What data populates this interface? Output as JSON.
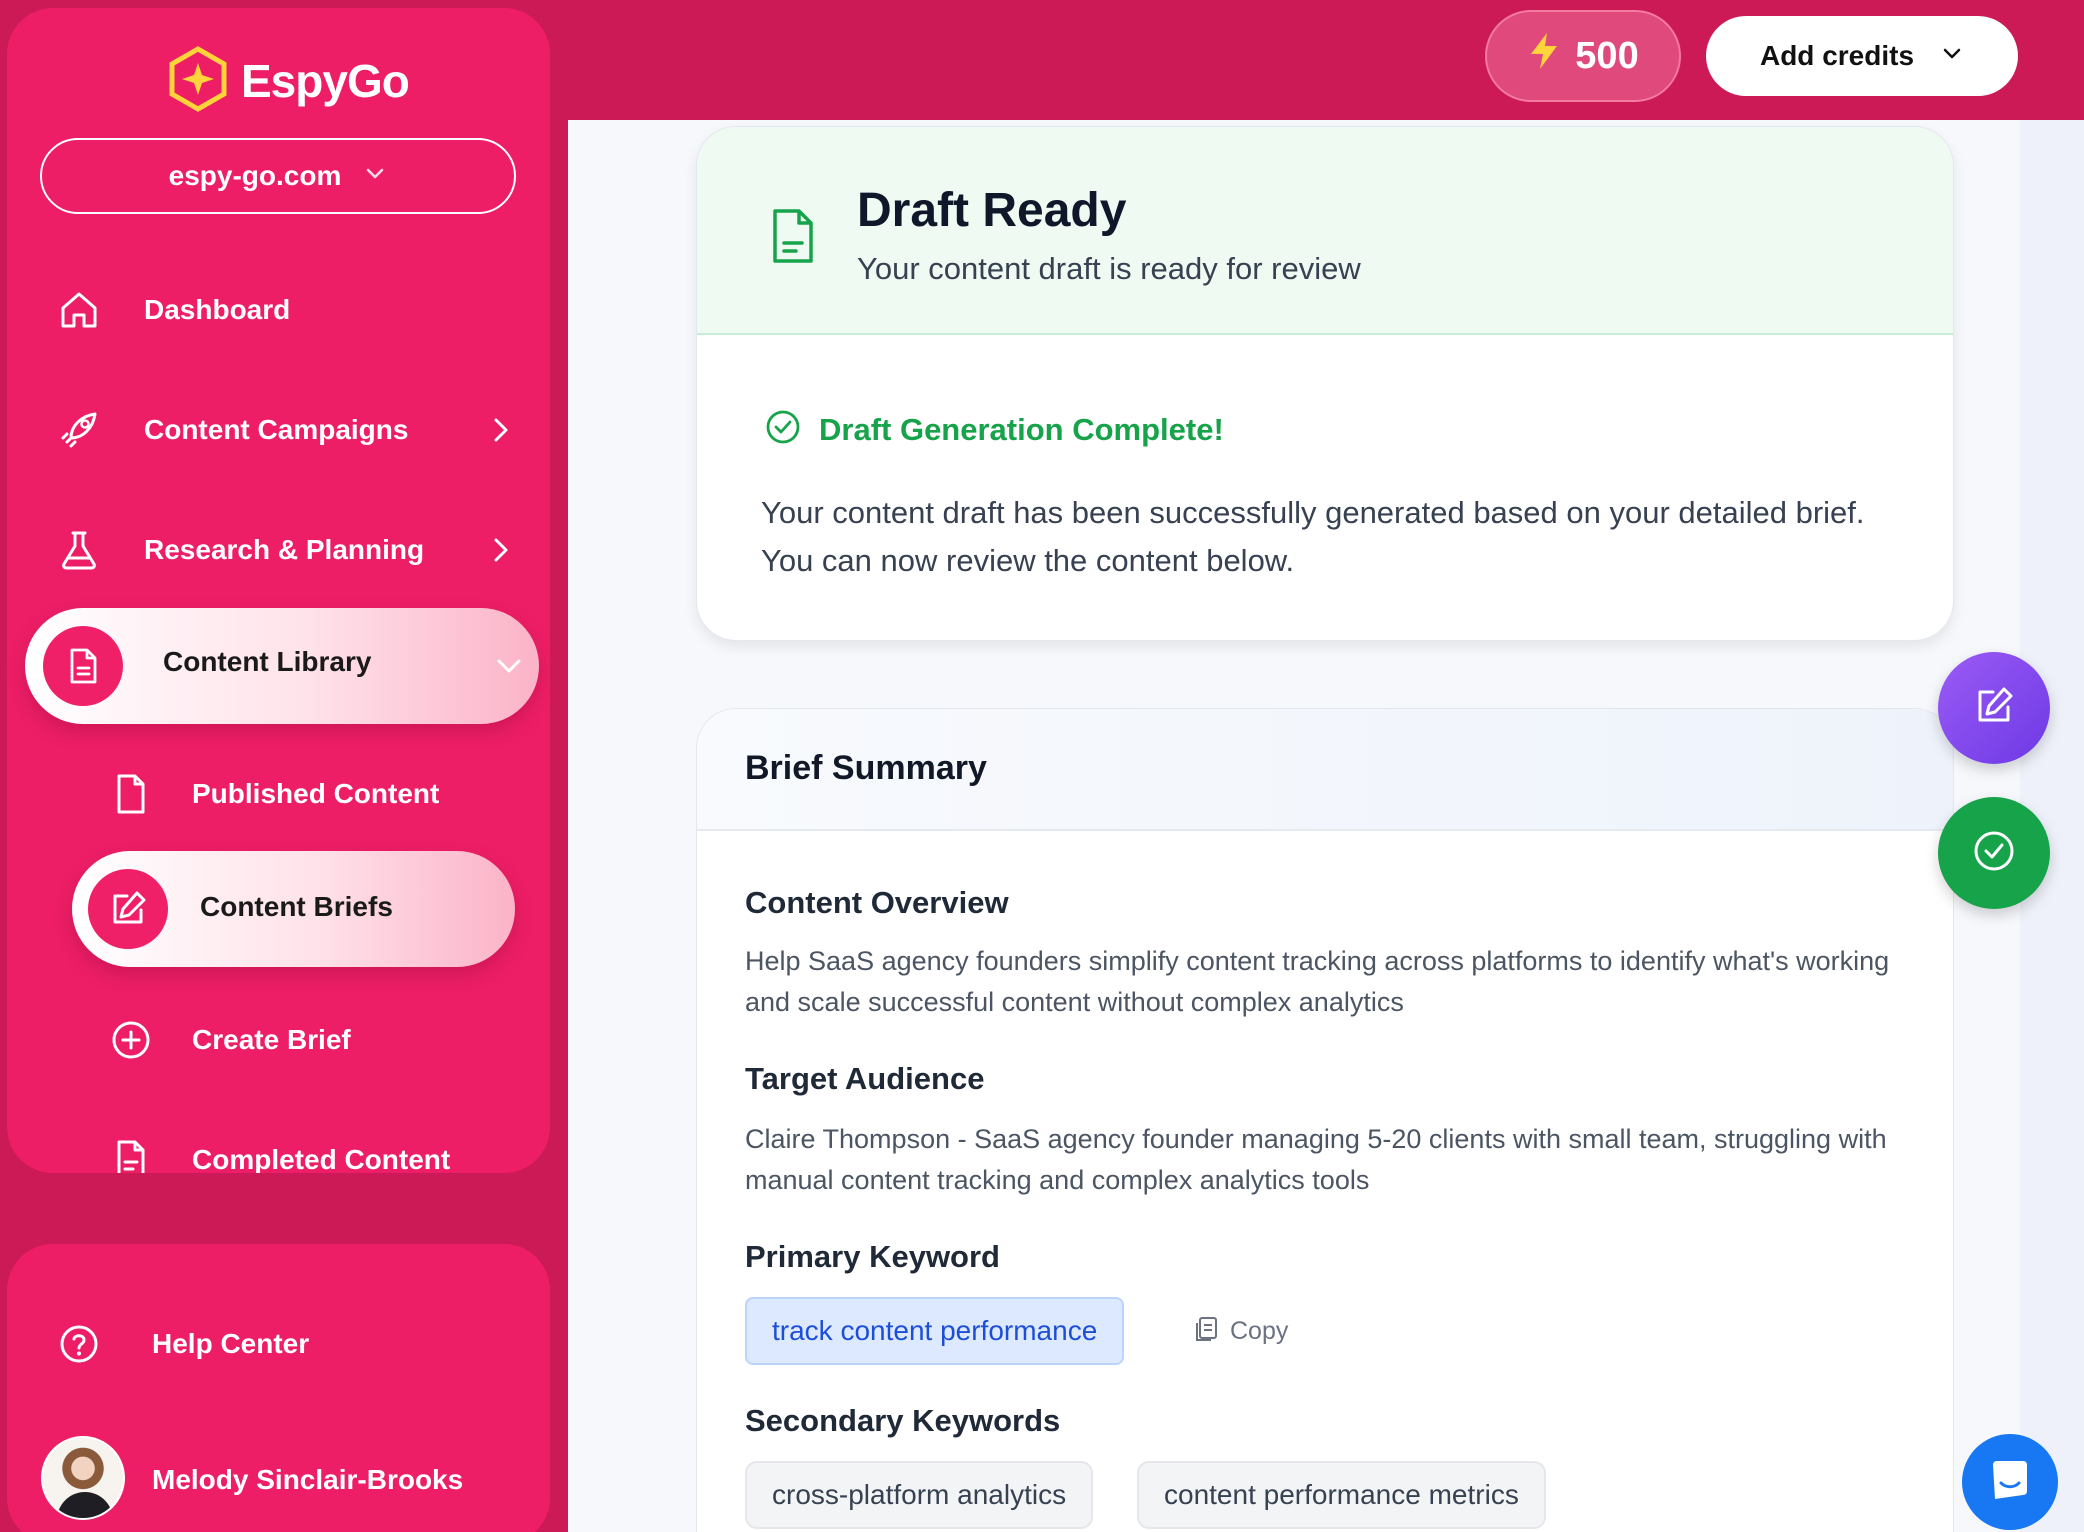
{
  "brand": {
    "name": "EspyGo",
    "logo_icon": "hexagon-star-icon"
  },
  "domain_select": {
    "value": "espy-go.com"
  },
  "nav": {
    "dashboard": "Dashboard",
    "campaigns": "Content Campaigns",
    "research": "Research & Planning",
    "library": "Content Library",
    "sub": {
      "published": "Published Content",
      "briefs": "Content Briefs",
      "create": "Create Brief",
      "completed": "Completed Content"
    },
    "help": "Help Center",
    "user": "Melody Sinclair-Brooks"
  },
  "topbar": {
    "credits": "500",
    "add_credits": "Add credits"
  },
  "draft": {
    "title": "Draft Ready",
    "subtitle": "Your content draft is ready for review",
    "status": "Draft Generation Complete!",
    "description": "Your content draft has been successfully generated based on your detailed brief. You can now review the content below."
  },
  "brief": {
    "title": "Brief Summary",
    "overview_h": "Content Overview",
    "overview": "Help SaaS agency founders simplify content tracking across platforms to identify what's working and scale successful content without complex analytics",
    "audience_h": "Target Audience",
    "audience": "Claire Thompson - SaaS agency founder managing 5-20 clients with small team, struggling with manual content tracking and complex analytics tools",
    "primary_h": "Primary Keyword",
    "primary_kw": "track content performance",
    "copy": "Copy",
    "secondary_h": "Secondary Keywords",
    "secondary_kw": [
      "cross-platform analytics",
      "content performance metrics"
    ]
  },
  "colors": {
    "brand": "#ed1e66",
    "success": "#16a34a",
    "accent_purple": "#7c3aed",
    "chat": "#1877f2"
  }
}
